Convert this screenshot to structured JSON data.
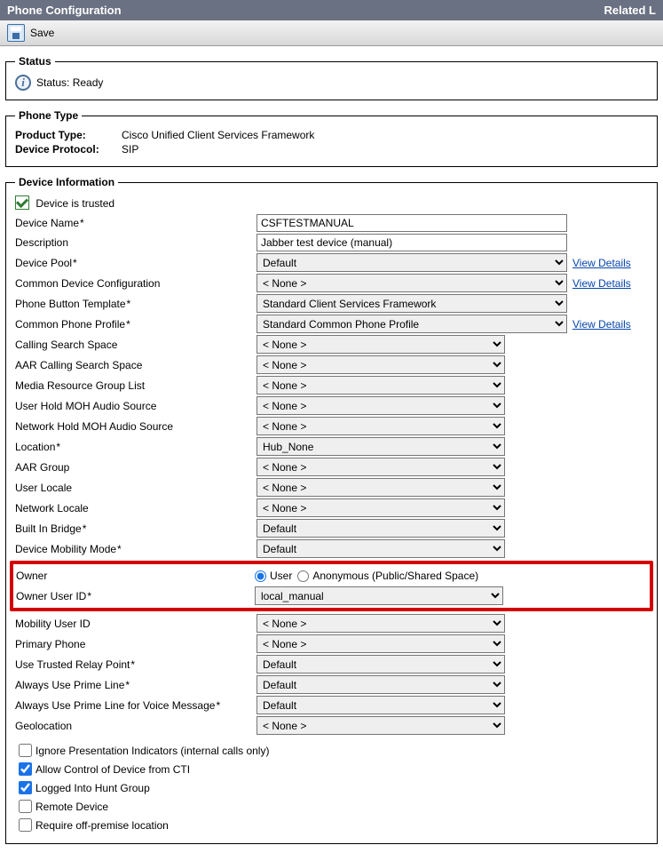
{
  "titlebar": {
    "left": "Phone Configuration",
    "right": "Related L"
  },
  "toolbar": {
    "save_label": "Save"
  },
  "status": {
    "legend": "Status",
    "text": "Status: Ready"
  },
  "phone_type": {
    "legend": "Phone Type",
    "product_type_label": "Product Type:",
    "product_type_value": "Cisco Unified Client Services Framework",
    "device_protocol_label": "Device Protocol:",
    "device_protocol_value": "SIP"
  },
  "device_info": {
    "legend": "Device Information",
    "trusted_label": "Device is trusted",
    "view_details": "View Details",
    "rows": {
      "device_name": {
        "label": "Device Name",
        "value": "CSFTESTMANUAL"
      },
      "description": {
        "label": "Description",
        "value": "Jabber test device (manual)"
      },
      "device_pool": {
        "label": "Device Pool",
        "value": "Default"
      },
      "common_dev_cfg": {
        "label": "Common Device Configuration",
        "value": "< None >"
      },
      "pbt": {
        "label": "Phone Button Template",
        "value": "Standard Client Services Framework"
      },
      "cpp": {
        "label": "Common Phone Profile",
        "value": "Standard Common Phone Profile"
      },
      "css": {
        "label": "Calling Search Space",
        "value": "< None >"
      },
      "aar_css": {
        "label": "AAR Calling Search Space",
        "value": "< None >"
      },
      "mrgl": {
        "label": "Media Resource Group List",
        "value": "< None >"
      },
      "user_moh": {
        "label": "User Hold MOH Audio Source",
        "value": "< None >"
      },
      "net_moh": {
        "label": "Network Hold MOH Audio Source",
        "value": "< None >"
      },
      "location": {
        "label": "Location",
        "value": "Hub_None"
      },
      "aar_group": {
        "label": "AAR Group",
        "value": "< None >"
      },
      "user_locale": {
        "label": "User Locale",
        "value": "< None >"
      },
      "net_locale": {
        "label": "Network Locale",
        "value": "< None >"
      },
      "bib": {
        "label": "Built In Bridge",
        "value": "Default"
      },
      "dmm": {
        "label": "Device Mobility Mode",
        "value": "Default"
      },
      "owner": {
        "label": "Owner",
        "opt_user": "User",
        "opt_anon": "Anonymous (Public/Shared Space)"
      },
      "owner_uid": {
        "label": "Owner User ID",
        "value": "local_manual"
      },
      "mobility_uid": {
        "label": "Mobility User ID",
        "value": "< None >"
      },
      "primary_phone": {
        "label": "Primary Phone",
        "value": "< None >"
      },
      "utrp": {
        "label": "Use Trusted Relay Point",
        "value": "Default"
      },
      "aupl": {
        "label": "Always Use Prime Line",
        "value": "Default"
      },
      "auplvm": {
        "label": "Always Use Prime Line for Voice Message",
        "value": "Default"
      },
      "geolocation": {
        "label": "Geolocation",
        "value": "< None >"
      }
    },
    "checks": {
      "ignore_pi": "Ignore Presentation Indicators (internal calls only)",
      "allow_cti": "Allow Control of Device from CTI",
      "logged_hunt": "Logged Into Hunt Group",
      "remote_dev": "Remote Device",
      "req_offprem": "Require off-premise location"
    }
  }
}
